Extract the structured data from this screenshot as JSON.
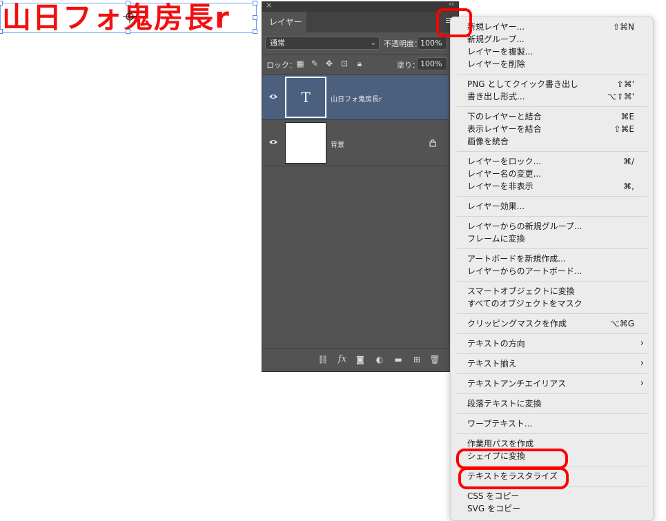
{
  "canvas": {
    "text": "山日フォ鬼房長r"
  },
  "panel": {
    "tab": "レイヤー",
    "blend_mode": "通常",
    "opacity_label": "不透明度：",
    "opacity_value": "100%",
    "lock_label": "ロック：",
    "fill_label": "塗り：",
    "fill_value": "100%",
    "layers": [
      {
        "name": "山日フォ鬼房長r",
        "thumb": "T",
        "selected": true
      },
      {
        "name": "背景",
        "locked": true
      }
    ]
  },
  "menu": {
    "groups": [
      [
        {
          "label": "新規レイヤー...",
          "shortcut": "⇧⌘N"
        },
        {
          "label": "新規グループ..."
        },
        {
          "label": "レイヤーを複製..."
        },
        {
          "label": "レイヤーを削除"
        }
      ],
      [
        {
          "label": "PNG としてクイック書き出し",
          "shortcut": "⇧⌘'"
        },
        {
          "label": "書き出し形式...",
          "shortcut": "⌥⇧⌘'"
        }
      ],
      [
        {
          "label": "下のレイヤーと結合",
          "shortcut": "⌘E"
        },
        {
          "label": "表示レイヤーを結合",
          "shortcut": "⇧⌘E"
        },
        {
          "label": "画像を統合"
        }
      ],
      [
        {
          "label": "レイヤーをロック...",
          "shortcut": "⌘/"
        },
        {
          "label": "レイヤー名の変更..."
        },
        {
          "label": "レイヤーを非表示",
          "shortcut": "⌘,"
        }
      ],
      [
        {
          "label": "レイヤー効果..."
        }
      ],
      [
        {
          "label": "レイヤーからの新規グループ..."
        },
        {
          "label": "フレームに変換"
        }
      ],
      [
        {
          "label": "アートボードを新規作成..."
        },
        {
          "label": "レイヤーからのアートボード..."
        }
      ],
      [
        {
          "label": "スマートオブジェクトに変換"
        },
        {
          "label": "すべてのオブジェクトをマスク"
        }
      ],
      [
        {
          "label": "クリッピングマスクを作成",
          "shortcut": "⌥⌘G"
        }
      ],
      [
        {
          "label": "テキストの方向",
          "submenu": true
        }
      ],
      [
        {
          "label": "テキスト揃え",
          "submenu": true
        }
      ],
      [
        {
          "label": "テキストアンチエイリアス",
          "submenu": true
        }
      ],
      [
        {
          "label": "段落テキストに変換"
        }
      ],
      [
        {
          "label": "ワープテキスト..."
        }
      ],
      [
        {
          "label": "作業用パスを作成"
        },
        {
          "label": "シェイプに変換"
        }
      ],
      [
        {
          "label": "テキストをラスタライズ"
        }
      ],
      [
        {
          "label": "CSS をコピー"
        },
        {
          "label": "SVG をコピー"
        }
      ]
    ]
  }
}
